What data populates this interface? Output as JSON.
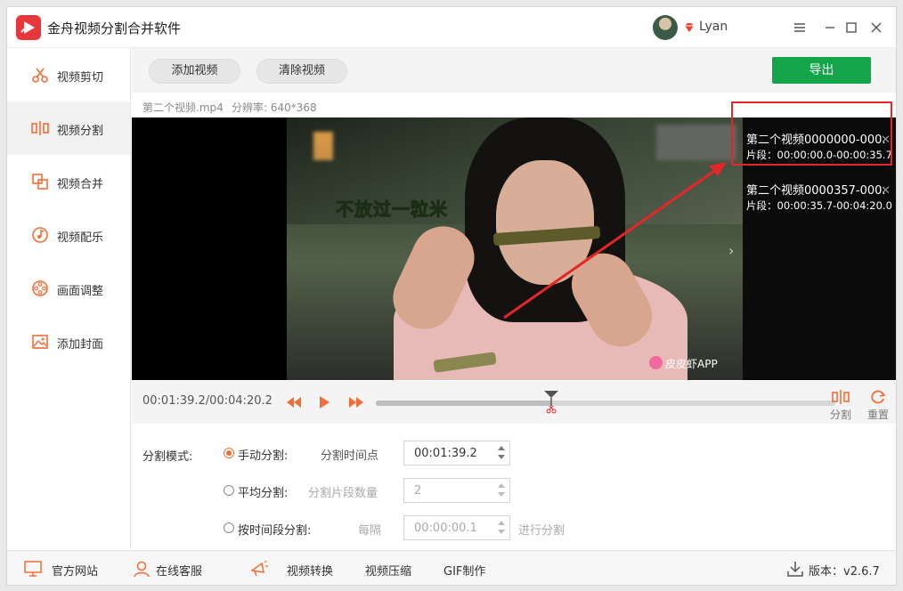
{
  "app": {
    "title": "金舟视频分割合并软件",
    "username": "Lyan"
  },
  "sidebar": {
    "items": [
      {
        "label": "视频剪切",
        "icon": "scissors-icon",
        "active": false
      },
      {
        "label": "视频分割",
        "icon": "split-icon",
        "active": true
      },
      {
        "label": "视频合并",
        "icon": "merge-icon",
        "active": false
      },
      {
        "label": "视频配乐",
        "icon": "music-icon",
        "active": false
      },
      {
        "label": "画面调整",
        "icon": "film-reel-icon",
        "active": false
      },
      {
        "label": "添加封面",
        "icon": "image-icon",
        "active": false
      }
    ]
  },
  "toolbar": {
    "add_label": "添加视频",
    "clear_label": "清除视频",
    "export_label": "导出"
  },
  "file": {
    "name": "第二个视频.mp4",
    "resolution": "分辨率: 640*368"
  },
  "video": {
    "subtitle": "不放过一粒米",
    "watermark": "皮皮虾APP"
  },
  "segments": [
    {
      "title": "第二个视频0000000-000...",
      "range": "片段：00:00:00.0-00:00:35.7"
    },
    {
      "title": "第二个视频0000357-000...",
      "range": "片段：00:00:35.7-00:04:20.0"
    }
  ],
  "controls": {
    "timecode": "00:01:39.2/00:04:20.2",
    "progress": 0.382,
    "split_label": "分割",
    "reset_label": "重置"
  },
  "settings": {
    "mode_label": "分割模式:",
    "modes": [
      {
        "label": "手动分割:",
        "checked": true,
        "field_label": "分割时间点",
        "value": "00:01:39.2",
        "disabled": false
      },
      {
        "label": "平均分割:",
        "checked": false,
        "field_label": "分割片段数量",
        "value": "2",
        "disabled": true
      },
      {
        "label": "按时间段分割:",
        "checked": false,
        "field_label": "每隔",
        "value": "00:00:00.1",
        "disabled": true,
        "suffix": "进行分割"
      }
    ]
  },
  "footer": {
    "website": "官方网站",
    "support": "在线客服",
    "convert": "视频转换",
    "compress": "视频压缩",
    "gif": "GIF制作",
    "version": "版本：v2.6.7"
  },
  "colors": {
    "accent": "#f36d36",
    "export": "#14a54a",
    "annotation": "#e3262a",
    "logo": "#e8373a"
  }
}
